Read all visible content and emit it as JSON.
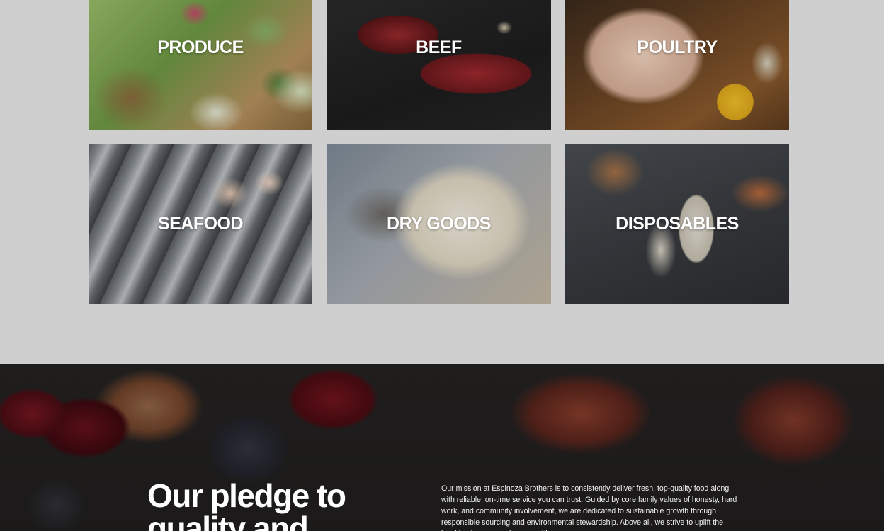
{
  "categories": [
    {
      "label": "PRODUCE"
    },
    {
      "label": "BEEF"
    },
    {
      "label": "POULTRY"
    },
    {
      "label": "SEAFOOD"
    },
    {
      "label": "DRY GOODS"
    },
    {
      "label": "DISPOSABLES"
    }
  ],
  "pledge": {
    "heading": "Our pledge to quality and",
    "body": "Our mission at Espinoza Brothers is to consistently deliver fresh, top-quality food along with reliable, on-time service you can trust. Guided by core family values of honesty, hard work, and community involvement, we are dedicated to sustainable growth through responsible sourcing and environmental stewardship. Above all, we strive to uplift the local businesses and communities"
  },
  "colors": {
    "page_background": "#cfcfcf",
    "label_text": "#ffffff"
  }
}
